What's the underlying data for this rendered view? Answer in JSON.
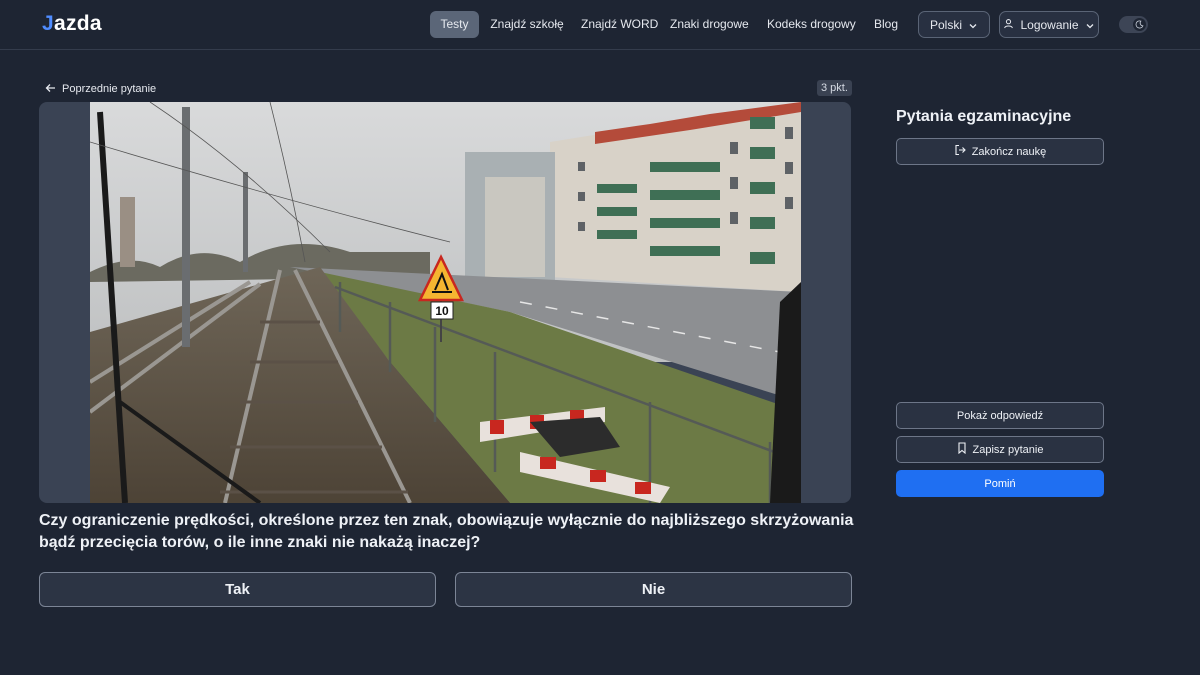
{
  "brand": {
    "logo_j": "J",
    "logo_rest": "azda"
  },
  "nav": {
    "items": [
      {
        "label": "Testy",
        "active": true
      },
      {
        "label": "Znajdź szkołę",
        "active": false
      },
      {
        "label": "Znajdź WORD",
        "active": false
      },
      {
        "label": "Znaki drogowe",
        "active": false
      },
      {
        "label": "Kodeks drogowy",
        "active": false
      },
      {
        "label": "Blog",
        "active": false
      }
    ],
    "language": "Polski",
    "login": "Logowanie"
  },
  "question": {
    "back_label": "Poprzednie pytanie",
    "points": "3 pkt.",
    "text": "Czy ograniczenie prędkości, określone przez ten znak, obowiązuje wyłącznie do najbliższego skrzyżowania bądź przecięcia torów, o ile inne znaki nie nakażą inaczej?",
    "answers": [
      "Tak",
      "Nie"
    ],
    "image": {
      "sign_speed_value": "10"
    }
  },
  "sidebar": {
    "title": "Pytania egzaminacyjne",
    "end_label": "Zakończ naukę",
    "show_answer_label": "Pokaż odpowiedź",
    "save_label": "Zapisz pytanie",
    "skip_label": "Pomiń"
  },
  "colors": {
    "background": "#1e2533",
    "accent": "#1f6ff2",
    "active_nav": "#5b6678"
  }
}
